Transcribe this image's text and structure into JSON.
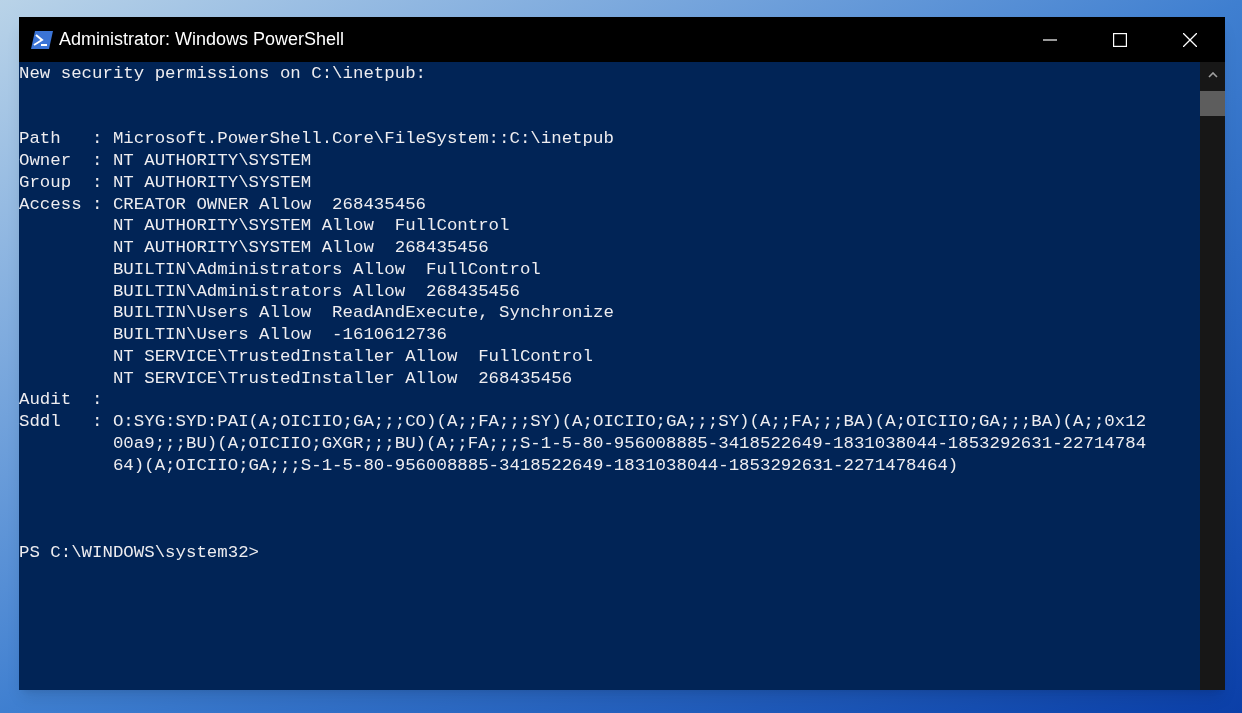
{
  "window": {
    "title": "Administrator: Windows PowerShell"
  },
  "console": {
    "lines": [
      {
        "kind": "text",
        "text": "New security permissions on C:\\inetpub:"
      },
      {
        "kind": "blank"
      },
      {
        "kind": "blank"
      },
      {
        "kind": "text",
        "text": "Path   : Microsoft.PowerShell.Core\\FileSystem::C:\\inetpub"
      },
      {
        "kind": "text",
        "text": "Owner  : NT AUTHORITY\\SYSTEM"
      },
      {
        "kind": "text",
        "text": "Group  : NT AUTHORITY\\SYSTEM"
      },
      {
        "kind": "text",
        "text": "Access : CREATOR OWNER Allow  268435456"
      },
      {
        "kind": "text",
        "text": "         NT AUTHORITY\\SYSTEM Allow  FullControl"
      },
      {
        "kind": "text",
        "text": "         NT AUTHORITY\\SYSTEM Allow  268435456"
      },
      {
        "kind": "text",
        "text": "         BUILTIN\\Administrators Allow  FullControl"
      },
      {
        "kind": "text",
        "text": "         BUILTIN\\Administrators Allow  268435456"
      },
      {
        "kind": "text",
        "text": "         BUILTIN\\Users Allow  ReadAndExecute, Synchronize"
      },
      {
        "kind": "text",
        "text": "         BUILTIN\\Users Allow  -1610612736"
      },
      {
        "kind": "text",
        "text": "         NT SERVICE\\TrustedInstaller Allow  FullControl"
      },
      {
        "kind": "text",
        "text": "         NT SERVICE\\TrustedInstaller Allow  268435456"
      },
      {
        "kind": "text",
        "text": "Audit  :"
      },
      {
        "kind": "text",
        "text": "Sddl   : O:SYG:SYD:PAI(A;OICIIO;GA;;;CO)(A;;FA;;;SY)(A;OICIIO;GA;;;SY)(A;;FA;;;BA)(A;OICIIO;GA;;;BA)(A;;0x12"
      },
      {
        "kind": "text",
        "text": "         00a9;;;BU)(A;OICIIO;GXGR;;;BU)(A;;FA;;;S-1-5-80-956008885-3418522649-1831038044-1853292631-22714784"
      },
      {
        "kind": "text",
        "text": "         64)(A;OICIIO;GA;;;S-1-5-80-956008885-3418522649-1831038044-1853292631-2271478464)"
      },
      {
        "kind": "blank"
      },
      {
        "kind": "blank"
      },
      {
        "kind": "blank"
      },
      {
        "kind": "text",
        "text": "PS C:\\WINDOWS\\system32>"
      }
    ]
  }
}
